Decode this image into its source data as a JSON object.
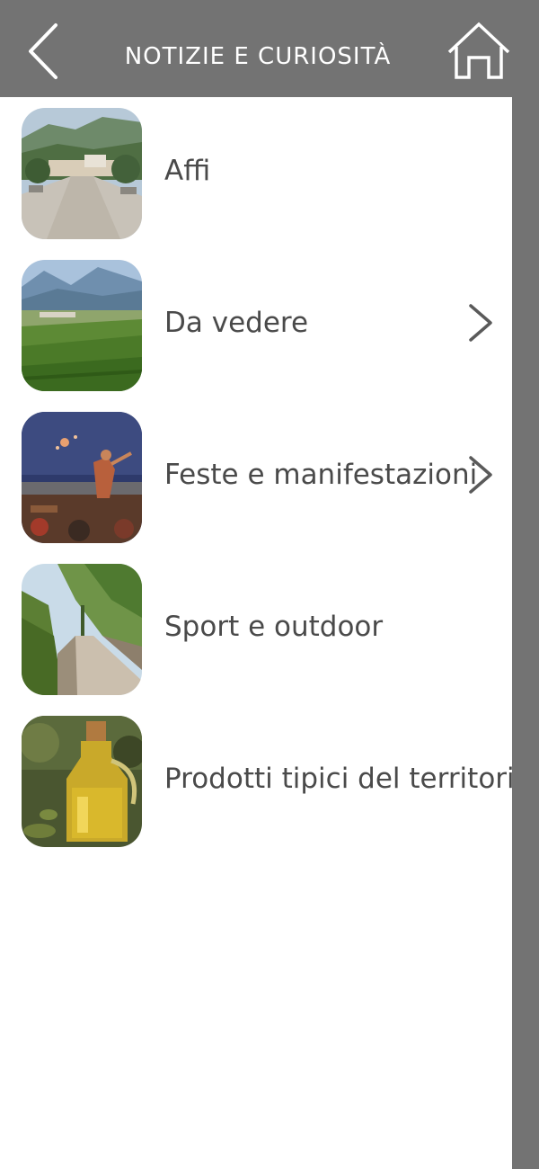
{
  "header": {
    "title": "NOTIZIE E CURIOSITÀ",
    "back_icon": "chevron-left-icon",
    "home_icon": "home-icon",
    "background_color": "#737373",
    "text_color": "#ffffff"
  },
  "menu": {
    "items": [
      {
        "label": "Affi",
        "thumbnail": "village-square-photo",
        "has_chevron": false
      },
      {
        "label": "Da vedere",
        "thumbnail": "vineyard-valley-photo",
        "has_chevron": true
      },
      {
        "label": "Feste e manifestazioni",
        "thumbnail": "festival-performer-photo",
        "has_chevron": true
      },
      {
        "label": "Sport e outdoor",
        "thumbnail": "countryside-path-photo",
        "has_chevron": false
      },
      {
        "label": "Prodotti tipici del territorio",
        "thumbnail": "olive-oil-bottle-photo",
        "has_chevron": false
      }
    ]
  },
  "theme": {
    "label_color": "#4a4a4a",
    "chevron_color": "#5a5a5a",
    "scrollbar_color": "#737373"
  }
}
